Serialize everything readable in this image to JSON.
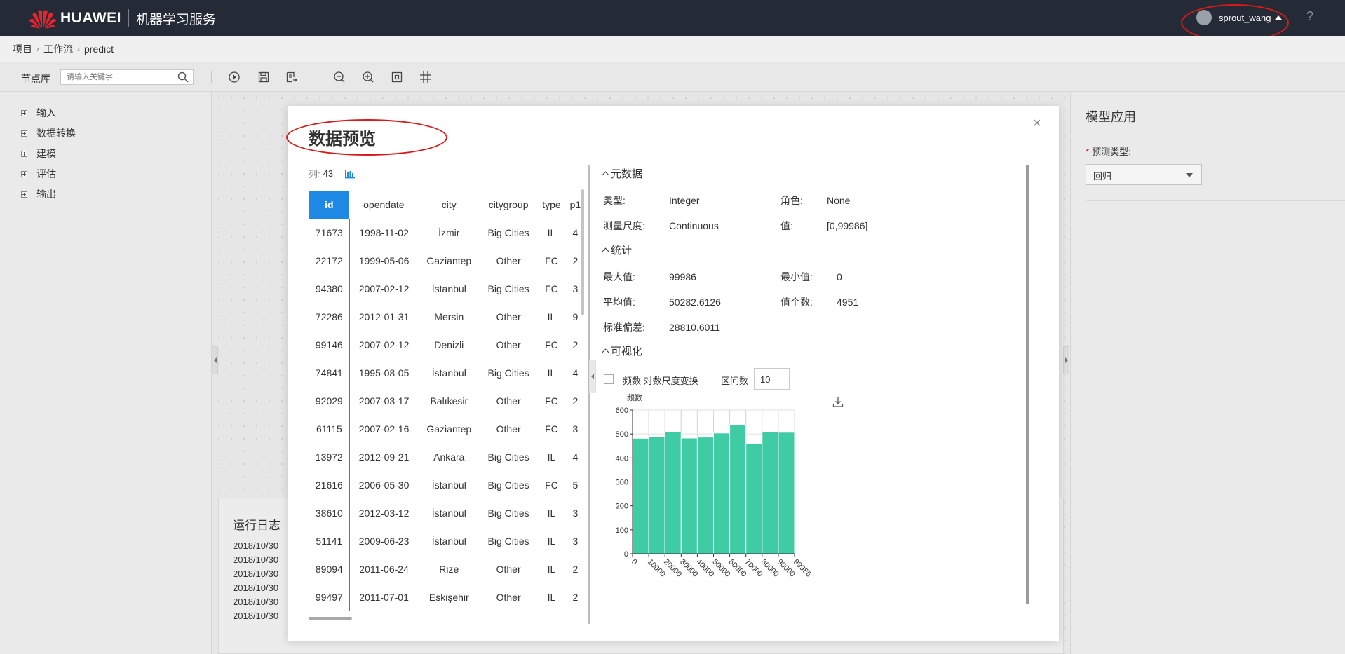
{
  "header": {
    "brand": "HUAWEI",
    "service": "机器学习服务",
    "username": "sprout_wang",
    "help": "?"
  },
  "breadcrumb": [
    "项目",
    "工作流",
    "predict"
  ],
  "toolbar": {
    "node_lib_label": "节点库",
    "search_placeholder": "请输入关键字",
    "icons": [
      "run-icon",
      "save-icon",
      "save-as-icon",
      "zoom-out-icon",
      "zoom-in-icon",
      "fit-screen-icon",
      "grid-icon"
    ]
  },
  "sidebar": {
    "items": [
      "输入",
      "数据转换",
      "建模",
      "评估",
      "输出"
    ]
  },
  "log_panel": {
    "title": "运行日志",
    "lines": [
      "2018/10/30",
      "2018/10/30",
      "2018/10/30",
      "2018/10/30",
      "2018/10/30",
      "2018/10/30"
    ]
  },
  "right_panel": {
    "title": "模型应用",
    "field_label": "预测类型:",
    "required_mark": "*",
    "select_value": "回归"
  },
  "modal": {
    "title": "数据预览",
    "close": "×",
    "col_count_label": "列:",
    "col_count": "43",
    "table": {
      "columns": [
        "id",
        "opendate",
        "city",
        "citygroup",
        "type",
        "p1"
      ],
      "rows": [
        [
          "71673",
          "1998-11-02",
          "İzmir",
          "Big Cities",
          "IL",
          "4"
        ],
        [
          "22172",
          "1999-05-06",
          "Gaziantep",
          "Other",
          "FC",
          "2"
        ],
        [
          "94380",
          "2007-02-12",
          "İstanbul",
          "Big Cities",
          "FC",
          "3"
        ],
        [
          "72286",
          "2012-01-31",
          "Mersin",
          "Other",
          "IL",
          "9"
        ],
        [
          "99146",
          "2007-02-12",
          "Denizli",
          "Other",
          "FC",
          "2"
        ],
        [
          "74841",
          "1995-08-05",
          "İstanbul",
          "Big Cities",
          "IL",
          "4"
        ],
        [
          "92029",
          "2007-03-17",
          "Balıkesir",
          "Other",
          "FC",
          "2"
        ],
        [
          "61115",
          "2007-02-16",
          "Gaziantep",
          "Other",
          "FC",
          "3"
        ],
        [
          "13972",
          "2012-09-21",
          "Ankara",
          "Big Cities",
          "IL",
          "4"
        ],
        [
          "21616",
          "2006-05-30",
          "İstanbul",
          "Big Cities",
          "FC",
          "5"
        ],
        [
          "38610",
          "2012-03-12",
          "İstanbul",
          "Big Cities",
          "IL",
          "3"
        ],
        [
          "51141",
          "2009-06-23",
          "İstanbul",
          "Big Cities",
          "IL",
          "3"
        ],
        [
          "89094",
          "2011-06-24",
          "Rize",
          "Other",
          "IL",
          "2"
        ],
        [
          "99497",
          "2011-07-01",
          "Eskişehir",
          "Other",
          "IL",
          "2"
        ]
      ]
    },
    "metadata": {
      "heading": "元数据",
      "type_label": "类型:",
      "type_value": "Integer",
      "role_label": "角色:",
      "role_value": "None",
      "scale_label": "测量尺度:",
      "scale_value": "Continuous",
      "range_label": "值:",
      "range_value": "[0,99986]"
    },
    "stats": {
      "heading": "统计",
      "max_label": "最大值:",
      "max_value": "99986",
      "min_label": "最小值:",
      "min_value": "0",
      "mean_label": "平均值:",
      "mean_value": "50282.6126",
      "count_label": "值个数:",
      "count_value": "4951",
      "std_label": "标准偏差:",
      "std_value": "28810.6011"
    },
    "viz": {
      "heading": "可视化",
      "checkbox_label": "频数 对数尺度变换",
      "bins_label": "区间数",
      "bins_value": "10"
    }
  },
  "chart_data": {
    "type": "bar",
    "ylabel": "频数",
    "ylim": [
      0,
      600
    ],
    "yticks": [
      0,
      100,
      200,
      300,
      400,
      500,
      600
    ],
    "xticks": [
      "0",
      "10000",
      "20000",
      "30000",
      "40000",
      "50000",
      "60000",
      "70000",
      "80000",
      "90000",
      "99986"
    ],
    "values": [
      482,
      490,
      508,
      483,
      487,
      504,
      537,
      460,
      508,
      507
    ],
    "bar_color": "#3fcba3",
    "grid": true
  },
  "colors": {
    "header_bg": "#242a36",
    "accent": "#1e88e5",
    "annotation": "#d71a1a"
  }
}
